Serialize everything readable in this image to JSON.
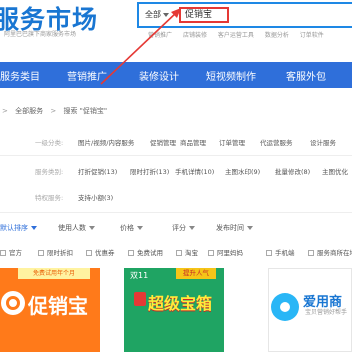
{
  "header": {
    "logo_text": "服务市场",
    "logo_sub": "阿里巴巴旗下商家服务市场",
    "search": {
      "scope_label": "全部",
      "query": "促销宝"
    },
    "hot_links": [
      "营销推广",
      "店铺装修",
      "客户运营工具",
      "数据分析",
      "订单软件"
    ]
  },
  "nav": {
    "items": [
      "服务类目",
      "营销推广",
      "装修设计",
      "短视频制作",
      "客服外包"
    ]
  },
  "breadcrumb": {
    "items": [
      "全部服务",
      "搜索 \"促销宝\""
    ],
    "separator": ">"
  },
  "filters": {
    "rows": [
      {
        "label": "一级分类:",
        "values": [
          "图片/视频/内容服务",
          "促销管理",
          "商品管理",
          "订单管理",
          "代运营服务",
          "设计服务"
        ]
      },
      {
        "label": "服务类别:",
        "values": [
          "打折促销(13)",
          "限时打折(13)",
          "手机详情(10)",
          "主图水印(9)",
          "批量修改(8)",
          "主图优化"
        ]
      },
      {
        "label": "特权服务:",
        "values": [
          "支持小额(3)"
        ]
      }
    ]
  },
  "sort_bar": {
    "items": [
      "默认排序",
      "使用人数",
      "价格",
      "评分",
      "发布时间"
    ]
  },
  "check_bar": {
    "items": [
      "官方",
      "限时折扣",
      "优惠券",
      "免费试用",
      "淘宝",
      "阿里妈妈",
      "手机端",
      "服务商所在地"
    ]
  },
  "cards": [
    {
      "badge": "免费试用年个月",
      "title": "促销宝"
    },
    {
      "top_label": "双11",
      "ribbon": "提升人气",
      "title": "超级宝箱"
    },
    {
      "title": "爱用商",
      "sub": "宝贝营销好帮手"
    }
  ],
  "colors": {
    "nav_bg": "#2f6fda",
    "accent": "#1e88e5",
    "highlight": "#e53935",
    "card_orange": "#ff7a1a",
    "card_green": "#1fa463"
  }
}
